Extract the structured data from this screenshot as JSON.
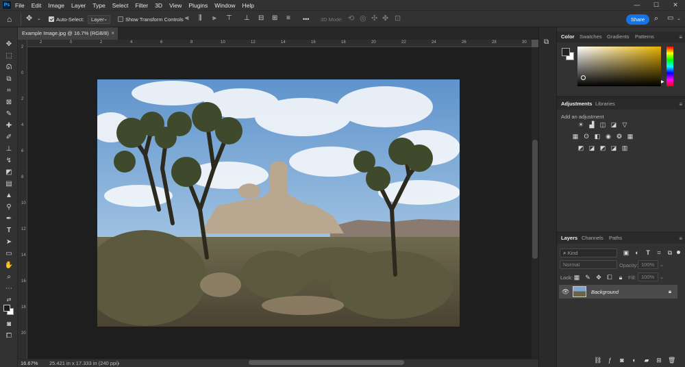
{
  "app": {
    "logo": "Ps"
  },
  "menu": [
    "File",
    "Edit",
    "Image",
    "Layer",
    "Type",
    "Select",
    "Filter",
    "3D",
    "View",
    "Plugins",
    "Window",
    "Help"
  ],
  "window_controls": {
    "minimize": "—",
    "maximize": "☐",
    "close": "✕"
  },
  "options": {
    "auto_select_label": "Auto-Select:",
    "auto_select_checked": true,
    "auto_select_value": "Layer",
    "transform_label": "Show Transform Controls",
    "transform_checked": false,
    "mode_label": "3D Mode:",
    "more": "•••",
    "share_label": "Share"
  },
  "document": {
    "tab_title": "Example Image.jpg @ 16.7% (RGB/8)",
    "close": "×"
  },
  "ruler": {
    "h_labels": [
      "2",
      "0",
      "2",
      "4",
      "6",
      "8",
      "10",
      "12",
      "14",
      "16",
      "18",
      "20",
      "22",
      "24",
      "26",
      "28",
      "30"
    ],
    "v_labels": [
      "2",
      "0",
      "2",
      "4",
      "6",
      "8",
      "10",
      "12",
      "14",
      "16",
      "18",
      "20"
    ]
  },
  "status": {
    "zoom": "16.67%",
    "info": "25.421 in x 17.333 in (240 ppi)",
    "arrow": "›"
  },
  "color_panel": {
    "tabs": [
      "Color",
      "Swatches",
      "Gradients",
      "Patterns"
    ],
    "active": "Color",
    "base_hue": "#e8b100"
  },
  "adjustments_panel": {
    "tabs": [
      "Adjustments",
      "Libraries"
    ],
    "active": "Adjustments",
    "hint": "Add an adjustment"
  },
  "layers_panel": {
    "tabs": [
      "Layers",
      "Channels",
      "Paths"
    ],
    "active": "Layers",
    "kind_placeholder": "Kind",
    "blend_mode": "Normal",
    "opacity_label": "Opacity:",
    "opacity_value": "100%",
    "lock_label": "Lock:",
    "fill_label": "Fill:",
    "fill_value": "100%",
    "layers": [
      {
        "name": "Background",
        "visible": true,
        "locked": true
      }
    ]
  },
  "colors": {
    "accent": "#1473e6",
    "menubar": "#323232",
    "canvas_bg": "#1e1e1e"
  }
}
